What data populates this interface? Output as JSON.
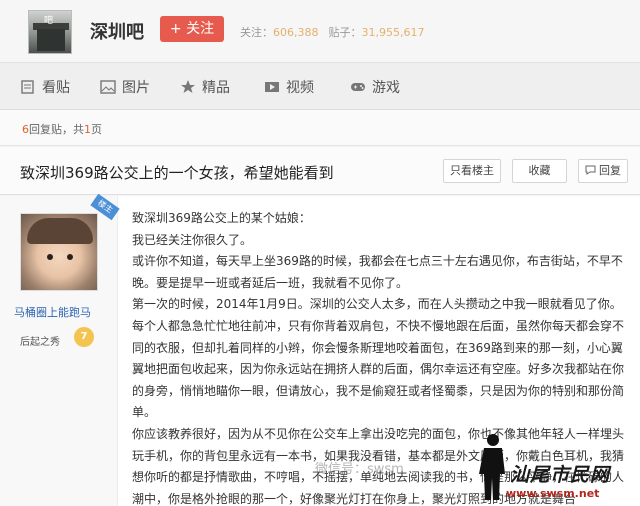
{
  "header": {
    "logo_glyph": "吧",
    "forum_name": "深圳吧",
    "follow_label": "+ 关注",
    "follow_label_label": "关注",
    "stats": {
      "followers_label": "关注：",
      "followers": "606,388",
      "posts_label": "贴子：",
      "posts": "31,955,617"
    }
  },
  "nav": [
    {
      "icon": "document-icon",
      "label": "看贴"
    },
    {
      "icon": "image-icon",
      "label": "图片"
    },
    {
      "icon": "star-icon",
      "label": "精品"
    },
    {
      "icon": "video-icon",
      "label": "视频"
    },
    {
      "icon": "gamepad-icon",
      "label": "游戏"
    }
  ],
  "pagebar": {
    "reply_count": "6",
    "reply_text": "回复贴，共",
    "page_count": "1",
    "page_suffix": "页"
  },
  "post": {
    "title": "致深圳369路公交上的一个女孩，希望她能看到",
    "buttons": {
      "only_op": "只看楼主",
      "favorite": "收藏",
      "reply": "回复"
    },
    "author": {
      "badge": "楼主",
      "name": "马桶圈上能跑马",
      "level_name": "后起之秀",
      "level": "7"
    },
    "paragraphs": [
      "致深圳369路公交上的某个姑娘：",
      "我已经关注你很久了。",
      "或许你不知道，每天早上坐369路的时候，我都会在七点三十左右遇见你，布吉街站，不早不晚。要是提早一班或者延后一班，我就看不见你了。",
      "第一次的时候，2014年1月9日。深圳的公交人太多，而在人头攒动之中我一眼就看见了你。每个人都急急忙忙地往前冲，只有你背着双肩包，不快不慢地跟在后面，虽然你每天都会穿不同的衣服，但却扎着同样的小辫，你会慢条斯理地咬着面包，在369路到来的那一刻，小心翼翼地把面包收起来，因为你永远站在拥挤人群的后面，偶尔幸运还有空座。好多次我都站在你的身旁，悄悄地瞄你一眼，但请放心，我不是偷窥狂或者怪蜀黍，只是因为你的特别和那份简单。",
      "你应该教养很好，因为从不见你在公交车上拿出没吃完的面包，你也不像其他年轻人一样埋头玩手机，你的背包里永远有一本书，如果我没看错，基本都是外文原版，你戴白色耳机，我猜想你听的都是抒情歌曲，不哼唱，不摇摆，单纯地去阅读我的书，你是那么平静，在忙碌的人潮中，你是格外抢眼的那一个，好像聚光灯打在你身上，聚光灯照到的地方就是舞台"
    ]
  },
  "watermark": {
    "text": "微信号：swsm",
    "logo": "汕尾市民网",
    "url": "www.swsm.net"
  },
  "colors": {
    "accent_red": "#e75b4f",
    "link_blue": "#2d64b3",
    "stat_orange": "#e3b16f",
    "url_red": "#b3261e"
  }
}
